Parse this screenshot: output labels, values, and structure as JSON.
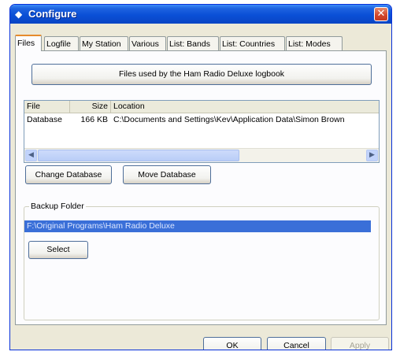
{
  "window": {
    "title": "Configure",
    "close_glyph": "✕"
  },
  "tabs": [
    {
      "label": "Files",
      "active": true
    },
    {
      "label": "Logfile",
      "active": false
    },
    {
      "label": "My Station",
      "active": false
    },
    {
      "label": "Various",
      "active": false
    },
    {
      "label": "List: Bands",
      "active": false
    },
    {
      "label": "List: Countries",
      "active": false
    },
    {
      "label": "List: Modes",
      "active": false
    }
  ],
  "files_panel": {
    "header_label": "Files used by the Ham Radio Deluxe logbook",
    "list": {
      "columns": [
        "File",
        "Size",
        "Location"
      ],
      "rows": [
        {
          "file": "Database",
          "size": "166 KB",
          "location": "C:\\Documents and Settings\\Kev\\Application Data\\Simon Brown"
        }
      ]
    },
    "change_database_label": "Change Database",
    "move_database_label": "Move Database",
    "backup_group_label": "Backup Folder",
    "backup_path": "F:\\Original Programs\\Ham Radio Deluxe",
    "select_label": "Select"
  },
  "footer": {
    "ok_label": "OK",
    "cancel_label": "Cancel",
    "apply_label": "Apply"
  },
  "icons": {
    "app_icon": "diamond-icon",
    "scroll_left": "arrow-left-icon",
    "scroll_right": "arrow-right-icon"
  },
  "colors": {
    "titlebar": "#0a4fd6",
    "close_button": "#d1452a",
    "selection": "#3a6fd8",
    "active_tab_accent": "#e68b2c"
  }
}
